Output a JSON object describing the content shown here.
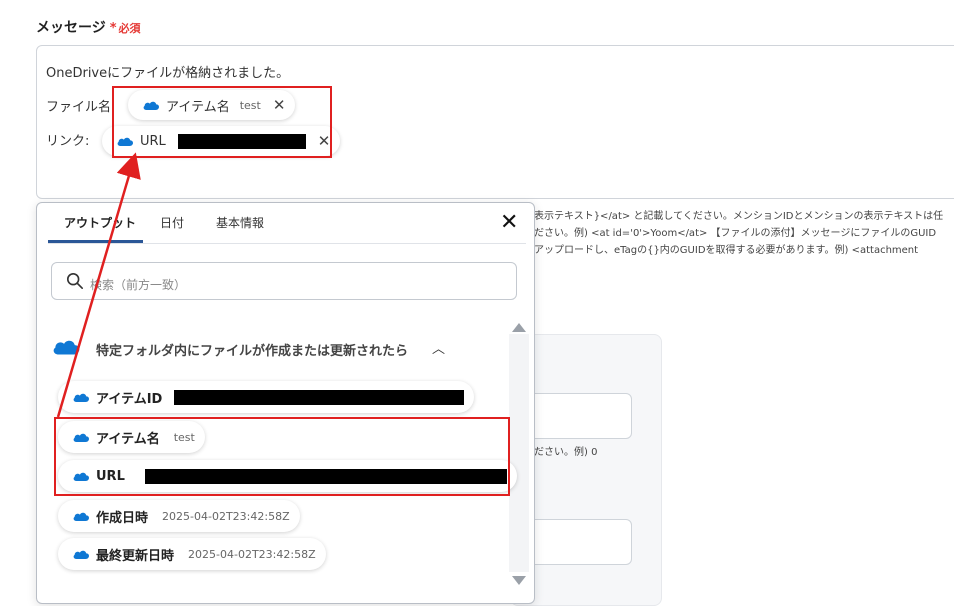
{
  "field": {
    "label": "メッセージ",
    "required_mark": "*",
    "required_text": "必須"
  },
  "message": {
    "line1": "OneDriveにファイルが格納されました。",
    "line2_prefix": "ファイル名:",
    "line3_prefix": "リンク:",
    "chip_item_name": {
      "label": "アイテム名",
      "sub": "test"
    },
    "chip_url": {
      "label": "URL"
    }
  },
  "help": {
    "line1": "表示テキスト}</at> と記載してください。メンションIDとメンションの表示テキストは任",
    "line2": "ださい。例) <at id='0'>Yoom</at>  【ファイルの添付】メッセージにファイルのGUID",
    "line3": "アップロードし、eTagの{}内のGUIDを取得する必要があります。例) <attachment",
    "line4": "ださい。例) 0"
  },
  "popup": {
    "tabs": [
      {
        "label": "アウトプット",
        "active": true
      },
      {
        "label": "日付",
        "active": false
      },
      {
        "label": "基本情報",
        "active": false
      }
    ],
    "close_icon": "close-icon",
    "search_placeholder": "検索（前方一致）",
    "group_title": "特定フォルダ内にファイルが作成または更新されたら",
    "items": [
      {
        "label": "アイテムID",
        "value": ""
      },
      {
        "label": "アイテム名",
        "value": "test"
      },
      {
        "label": "URL",
        "value": ""
      },
      {
        "label": "作成日時",
        "value": "2025-04-02T23:42:58Z"
      },
      {
        "label": "最終更新日時",
        "value": "2025-04-02T23:42:58Z"
      }
    ]
  },
  "colors": {
    "accent": "#2b5797",
    "highlight_red": "#e02020",
    "onedrive_blue": "#0f78d4"
  }
}
